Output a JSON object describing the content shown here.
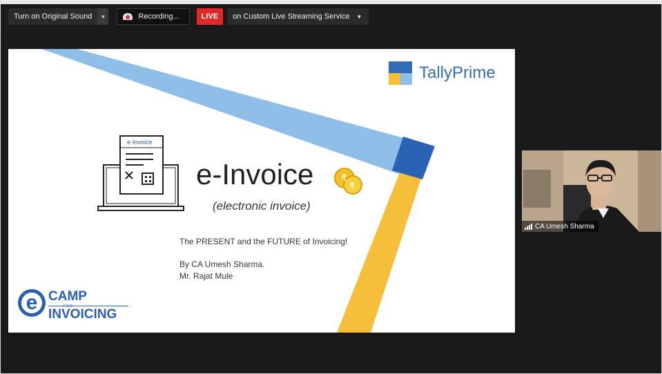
{
  "toolbar": {
    "original_sound_label": "Turn on Original Sound",
    "recording_label": "Recording...",
    "live_label": "LIVE",
    "stream_label": "on Custom Live Streaming Service"
  },
  "slide": {
    "brand": "TallyPrime",
    "doc_tag": "e-Invoice",
    "title": "e-Invoice",
    "subtitle": "(electronic invoice)",
    "tagline": "The PRESENT and the FUTURE of Invoicing!",
    "author1": "By CA Umesh Sharma.",
    "author2": "Mr. Rajat Mule",
    "ecamp": {
      "camp": "CAMP",
      "for": "FOR",
      "invoicing": "INVOICING"
    }
  },
  "participant": {
    "name": "CA Umesh Sharma"
  },
  "colors": {
    "live_red": "#e02828",
    "stripe_blue": "#8fbfe8",
    "stripe_yellow": "#f6bf3a",
    "accent_dark_blue": "#2b5fb0",
    "tally_blue": "#2f6db5"
  }
}
